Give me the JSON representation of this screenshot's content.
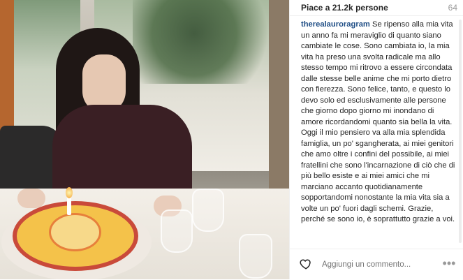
{
  "header": {
    "likes_text": "Piace a 21.2k persone",
    "time_text": "64"
  },
  "caption": {
    "username": "therealauroragram",
    "text": "Se ripenso alla mia vita un anno fa mi meraviglio di quanto siano cambiate le cose. Sono cambiata io, la mia vita ha preso una svolta radicale ma allo stesso tempo mi ritrovo a essere circondata dalle stesse belle anime che mi porto dietro con fierezza. Sono felice, tanto, e questo lo devo solo ed esclusivamente alle persone che giorno dopo giorno mi inondano di amore ricordandomi quanto sia bella la vita. Oggi il mio pensiero va alla mia splendida famiglia, un po' sgangherata, ai miei genitori che amo oltre i confini del possibile, ai miei fratellini che sono l'incarnazione di ciò che di più bello esiste e ai miei amici che mi marciano accanto quotidianamente sopportandomi nonostante la mia vita sia a volte un po' fuori dagli schemi. Grazie, perché se sono io, è soprattutto grazie a voi."
  },
  "footer": {
    "comment_placeholder": "Aggiungi un commento...",
    "more_label": "•••"
  },
  "icons": {
    "like": "heart-outline-icon",
    "more": "more-options-icon"
  },
  "colors": {
    "username": "#1f4e86",
    "text": "#262626",
    "muted": "#999999"
  }
}
